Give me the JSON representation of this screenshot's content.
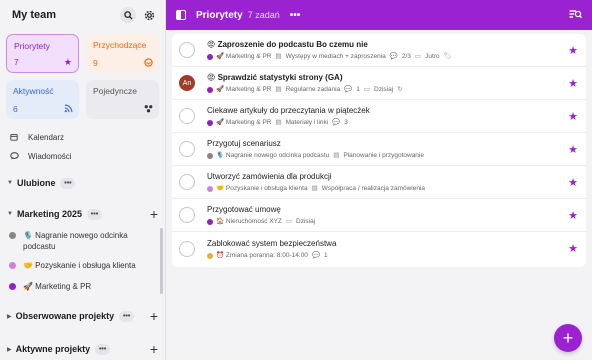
{
  "sidebar": {
    "team_name": "My team",
    "tiles": [
      {
        "label": "Priorytety",
        "count": "7",
        "icon": "star-icon"
      },
      {
        "label": "Przychodzące",
        "count": "9",
        "icon": "inbox-icon"
      },
      {
        "label": "Aktywność",
        "count": "6",
        "icon": "rss-icon"
      },
      {
        "label": "Pojedyncze",
        "count": "",
        "icon": "dots-icon"
      }
    ],
    "links": [
      {
        "label": "Kalendarz",
        "icon": "calendar-icon"
      },
      {
        "label": "Wiadomości",
        "icon": "chat-icon"
      }
    ],
    "sections": {
      "favorites": "Ulubione",
      "marketing": "Marketing 2025",
      "observed": "Obserwowane projekty",
      "active": "Aktywne projekty"
    },
    "projects": [
      {
        "label": "🎙️ Nagranie nowego odcinka podcastu",
        "color": "#8a8580"
      },
      {
        "label": "🤝 Pozyskanie i obsługa klienta",
        "color": "#d47fd8"
      },
      {
        "label": "🚀 Marketing & PR",
        "color": "#8f22c3"
      }
    ]
  },
  "topbar": {
    "title": "Priorytety",
    "count": "7 zadań"
  },
  "tasks": [
    {
      "title": "😡 Zaproszenie do podcastu Bo czemu nie",
      "bold": true,
      "project": "🚀 Marketing & PR",
      "project_color": "#8f22c3",
      "meta": [
        "Występy w mediach + zaproszenia",
        "2/3",
        "Jutro",
        "🏷"
      ],
      "avatar": ""
    },
    {
      "title": "😡 Sprawdzić statystyki strony (GA)",
      "bold": true,
      "project": "🚀 Marketing & PR",
      "project_color": "#8f22c3",
      "meta": [
        "Regularne zadania",
        "1",
        "Dzisiaj",
        "↻"
      ],
      "avatar": "An"
    },
    {
      "title": "Ciekawe artykuły do przeczytania w piątecżek",
      "bold": false,
      "project": "🚀 Marketing & PR",
      "project_color": "#8f22c3",
      "meta": [
        "Materiały i linki",
        "3"
      ],
      "avatar": ""
    },
    {
      "title": "Przygotuj scenariusz",
      "bold": false,
      "project": "🎙️ Nagranie nowego odcinka podcastu",
      "project_color": "#8a8580",
      "meta": [
        "Planowanie i przygotowanie"
      ],
      "avatar": ""
    },
    {
      "title": "Utworzyć zamówienia dla produkcji",
      "bold": false,
      "project": "🤝 Pozyskanie i obsługa klienta",
      "project_color": "#d47fd8",
      "meta": [
        "Współpraca / realizacja zamówienia"
      ],
      "avatar": ""
    },
    {
      "title": "Przygotować umowę",
      "bold": false,
      "project": "🏠 Nieruchomość XYZ",
      "project_color": "#8f22c3",
      "meta": [
        "Dzisiaj"
      ],
      "avatar": ""
    },
    {
      "title": "Zablokować system bezpieczeństwa",
      "bold": false,
      "project": "⏰ Zmiana poranna: 8:00-14:00",
      "project_color": "#e0b43a",
      "meta": [
        "1"
      ],
      "avatar": ""
    }
  ],
  "colors": {
    "accent": "#9a22d0",
    "priority_tile_bg": "#f1defa",
    "inbox_color": "#e46b13",
    "activity_color": "#3b66d4"
  }
}
